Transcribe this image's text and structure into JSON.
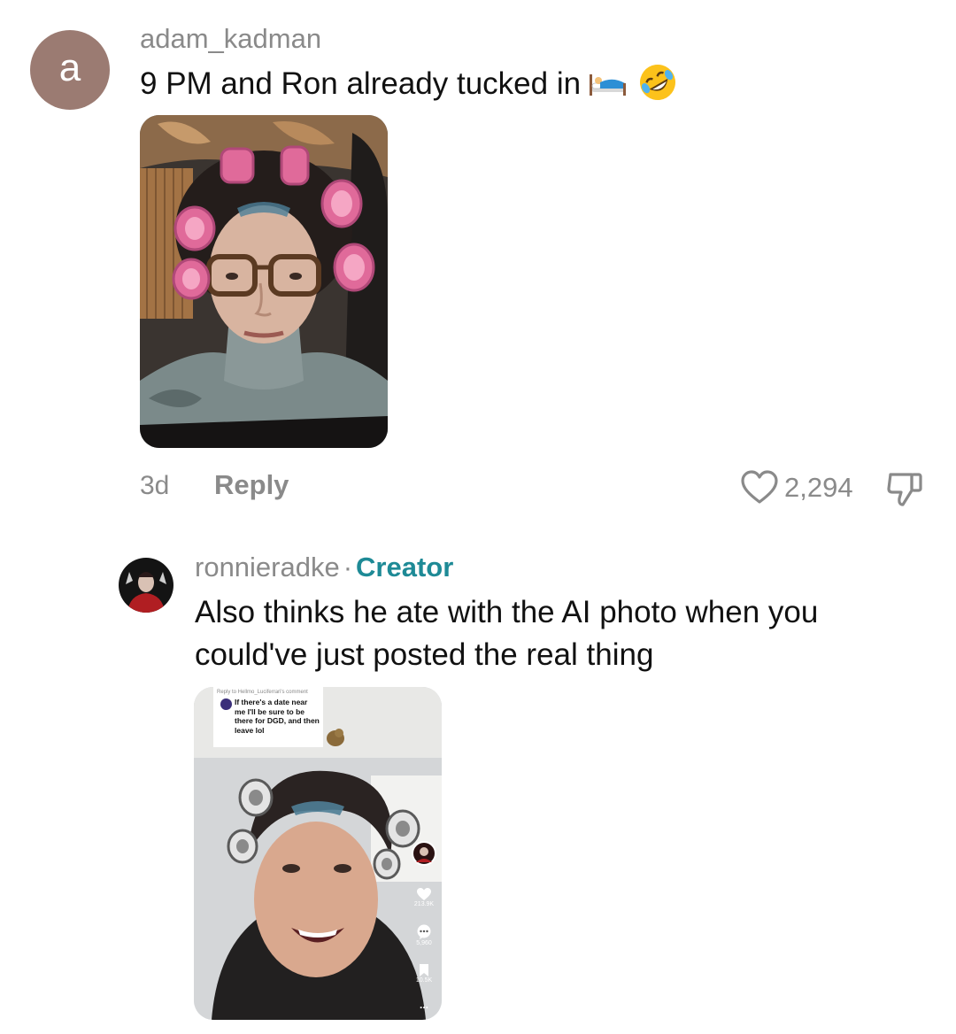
{
  "comment1": {
    "avatar_letter": "a",
    "username": "adam_kadman",
    "text": "9 PM and Ron already tucked in",
    "emoji_bed": "bed-emoji",
    "emoji_laugh": "rolling-on-floor-laughing-emoji",
    "time": "3d",
    "reply_label": "Reply",
    "like_count": "2,294"
  },
  "comment2": {
    "username": "ronnieradke",
    "separator": "·",
    "badge": "Creator",
    "text": "Also thinks he ate with the AI photo when you could've just posted the real thing",
    "video": {
      "reply_header": "Reply to Hellmo_Luciferrari's comment",
      "reply_body": "If there's a date near me I'll be sure to be there for DGD, and then leave lol",
      "likes": "213.9K",
      "comments": "5,960",
      "saves": "10.5K",
      "more": "..."
    }
  },
  "colors": {
    "avatar_bg": "#9b7b72",
    "creator_accent": "#1e8a96",
    "muted_text": "#8a8a8a"
  }
}
